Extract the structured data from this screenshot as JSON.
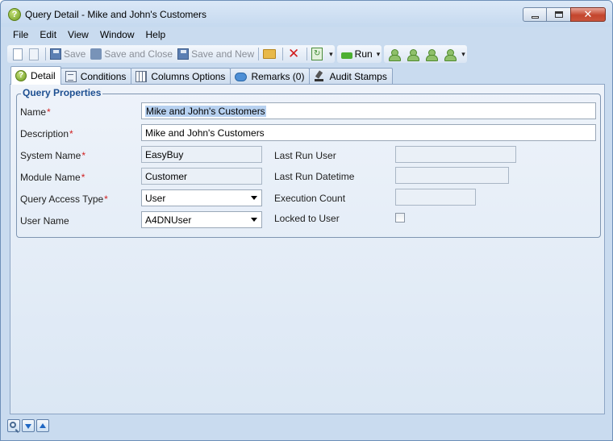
{
  "window": {
    "title": "Query Detail - Mike and John's Customers",
    "close_symbol": "✕"
  },
  "menu": [
    "File",
    "Edit",
    "View",
    "Window",
    "Help"
  ],
  "toolbar": {
    "save_label": "Save",
    "save_close_label": "Save and Close",
    "save_new_label": "Save and New",
    "delete_symbol": "✕",
    "run_label": "Run",
    "dropdown_symbol": "▾"
  },
  "tabs": [
    "Detail",
    "Conditions",
    "Columns Options",
    "Remarks (0)",
    "Audit Stamps"
  ],
  "active_tab": "Detail",
  "group": {
    "title": "Query Properties"
  },
  "form": {
    "name_label": "Name",
    "name_value": "Mike and John's Customers",
    "description_label": "Description",
    "description_value": "Mike and John's Customers",
    "system_name_label": "System Name",
    "system_name_value": "EasyBuy",
    "module_name_label": "Module Name",
    "module_name_value": "Customer",
    "access_type_label": "Query Access Type",
    "access_type_value": "User",
    "user_name_label": "User Name",
    "user_name_value": "A4DNUser",
    "last_run_user_label": "Last Run User",
    "last_run_user_value": "",
    "last_run_datetime_label": "Last Run Datetime",
    "last_run_datetime_value": "",
    "execution_count_label": "Execution Count",
    "execution_count_value": "",
    "locked_label": "Locked to User",
    "locked_checked": false,
    "required_mark": "*"
  },
  "colors": {
    "accent_title": "#1d4f91",
    "required": "#d01f1f",
    "selection": "#b7d1f0"
  }
}
